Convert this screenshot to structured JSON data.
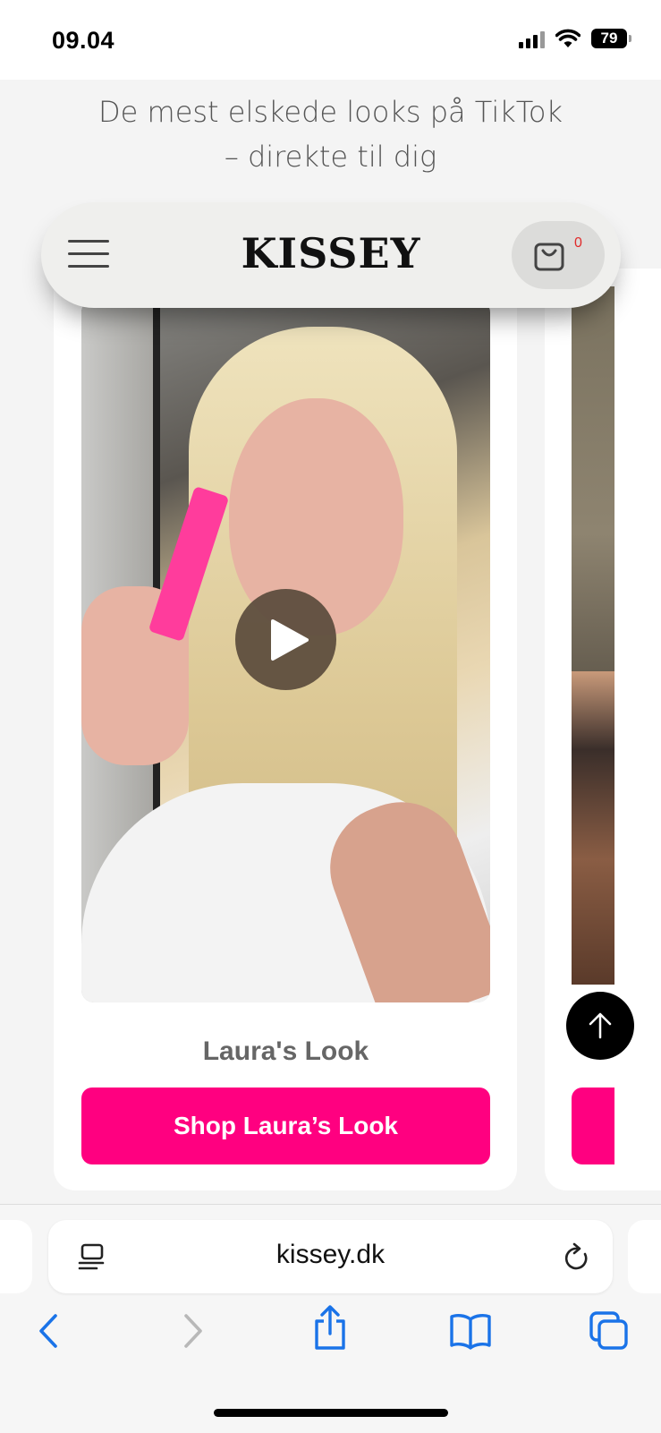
{
  "status": {
    "time": "09.04",
    "battery": "79"
  },
  "page": {
    "tagline_line1": "De mest elskede looks på TikTok",
    "tagline_line2": "– direkte til dig"
  },
  "header": {
    "logo": "KISSEY",
    "cart_count": "0",
    "icons": {
      "menu": "hamburger-icon",
      "cart": "shopping-bag-icon"
    }
  },
  "card": {
    "title": "Laura's Look",
    "button_label": "Shop Laura’s Look",
    "video_control": "play-icon"
  },
  "colors": {
    "accent": "#ff0080",
    "cart_badge": "#e02a2a"
  },
  "browser": {
    "url": "kissey.dk",
    "toolbar_icons": [
      "back-icon",
      "forward-icon",
      "share-icon",
      "bookmarks-icon",
      "tabs-icon"
    ]
  }
}
